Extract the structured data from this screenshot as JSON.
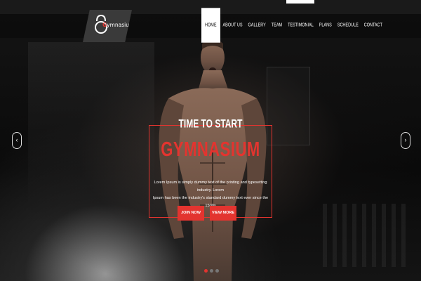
{
  "brand": {
    "logo_prefix": "G",
    "logo_text": "ymnasium"
  },
  "nav": {
    "items": [
      "HOME",
      "ABOUT US",
      "GALLERY",
      "TEAM",
      "TESTIMONIAL",
      "PLANS",
      "SCHEDULE",
      "CONTACT"
    ],
    "active": "HOME"
  },
  "hero": {
    "kicker": "TIME TO START",
    "headline": "GYMNASIUM",
    "description_line1": "Lorem Ipsum is simply dummy text of the printing and typesetting industry. Lorem",
    "description_line2": "Ipsum has been the industry's standard dummy text ever since the 1500s",
    "join_label": "JOIN NOW",
    "view_label": "VIEW MORE"
  },
  "slider": {
    "prev_icon": "chevron-left-icon",
    "next_icon": "chevron-right-icon",
    "slide_count": 3,
    "active_index": 0
  },
  "colors": {
    "accent": "#e3342f",
    "background": "#0c0c0c"
  }
}
